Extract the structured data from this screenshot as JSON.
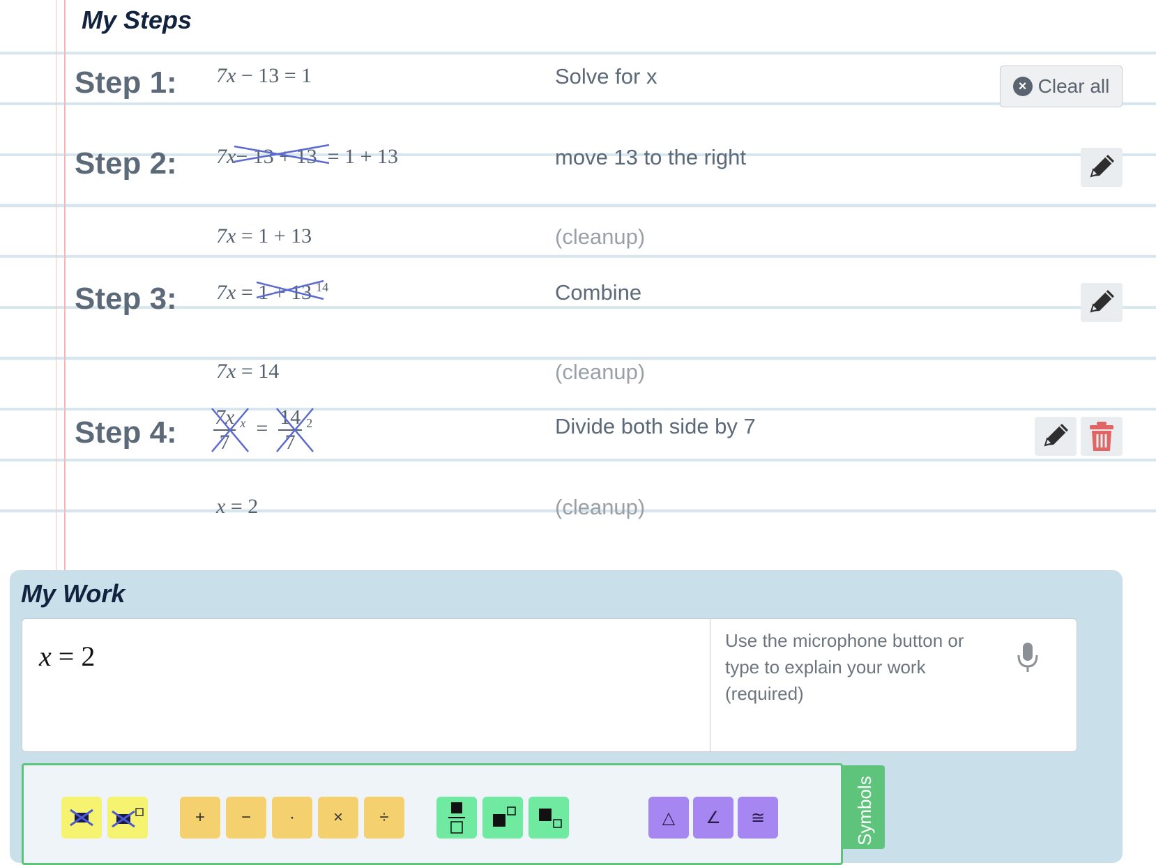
{
  "steps_section": {
    "title": "My Steps",
    "clear_all_label": "Clear all"
  },
  "steps": [
    {
      "label": "Step 1:",
      "description": "Solve for x"
    },
    {
      "label": "Step 2:",
      "description": "move 13 to the right",
      "cleanup": "(cleanup)"
    },
    {
      "label": "Step 3:",
      "description": "Combine",
      "cleanup": "(cleanup)"
    },
    {
      "label": "Step 4:",
      "description": "Divide both side by 7",
      "cleanup": "(cleanup)"
    }
  ],
  "work_section": {
    "title": "My Work",
    "explain_placeholder": "Use the microphone button or type to explain your work (required)"
  },
  "keyboard": {
    "tab_label": "Symbols",
    "operator_keys": [
      "+",
      "−",
      "·",
      "×",
      "÷"
    ],
    "geometry_keys": [
      "△",
      "∠",
      "≅"
    ]
  },
  "colors": {
    "accent_green": "#5ec47c",
    "panel_blue": "#c9e0ea",
    "delete_red": "#e06666"
  }
}
